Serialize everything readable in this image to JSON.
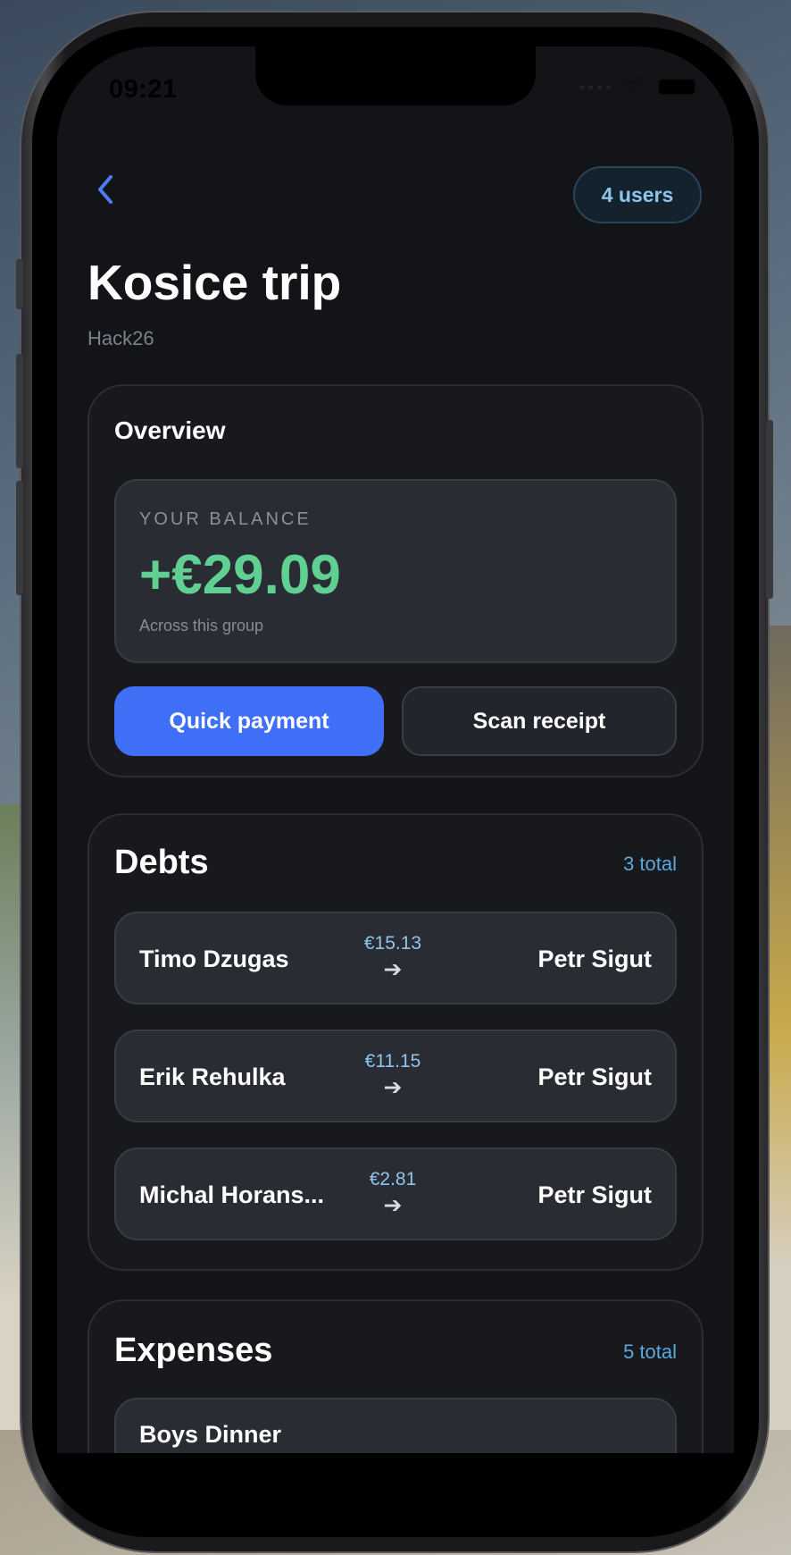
{
  "status_bar": {
    "time": "09:21"
  },
  "header": {
    "users_badge": "4 users",
    "title": "Kosice trip",
    "subtitle": "Hack26"
  },
  "overview": {
    "title": "Overview",
    "balance_label": "YOUR BALANCE",
    "balance_value": "+€29.09",
    "balance_note": "Across this group",
    "quick_payment_label": "Quick payment",
    "scan_receipt_label": "Scan receipt"
  },
  "debts": {
    "title": "Debts",
    "count": "3 total",
    "items": [
      {
        "from": "Timo Dzugas",
        "amount": "€15.13",
        "to": "Petr Sigut"
      },
      {
        "from": "Erik Rehulka",
        "amount": "€11.15",
        "to": "Petr Sigut"
      },
      {
        "from": "Michal Horans...",
        "amount": "€2.81",
        "to": "Petr Sigut"
      }
    ]
  },
  "expenses": {
    "title": "Expenses",
    "count": "5 total",
    "items": [
      {
        "name": "Boys Dinner"
      }
    ]
  },
  "icons": {
    "back": "chevron-left-icon",
    "arrow": "arrow-right-icon",
    "wifi": "wifi-icon",
    "battery": "battery-icon"
  },
  "colors": {
    "accent": "#3f6ef7",
    "positive": "#5fcf92",
    "link": "#5aa8de"
  }
}
